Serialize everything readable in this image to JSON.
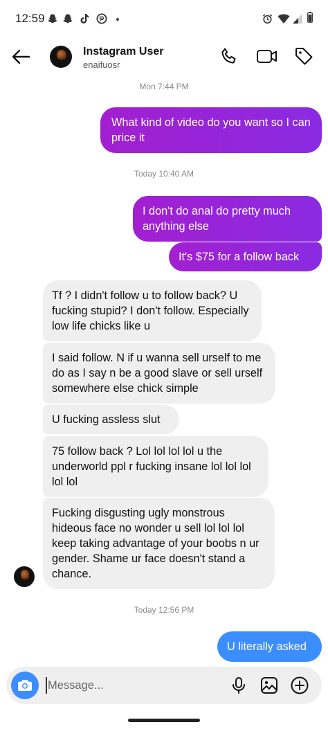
{
  "status_bar": {
    "time": "12:59",
    "icons": [
      "snapchat-icon",
      "snapchat-icon",
      "tiktok-icon",
      "pinterest-icon",
      "dot-icon",
      "alarm-icon",
      "wifi-icon",
      "signal-icon",
      "battery-icon"
    ]
  },
  "header": {
    "name": "Instagram User",
    "username": "enaifuosr",
    "icons": [
      "back-arrow-icon",
      "phone-icon",
      "video-camera-icon",
      "tag-icon"
    ]
  },
  "timestamps": [
    "Mon 7:44 PM",
    "Today 10:40 AM",
    "Today 12:56 PM"
  ],
  "messages": [
    {
      "from": "me",
      "text": "What kind of video do you want so I can price it"
    },
    {
      "from": "me",
      "text": "I don't do anal do pretty much anything else"
    },
    {
      "from": "me",
      "text": "It's $75 for a follow back"
    },
    {
      "from": "them",
      "text": "Tf ? I didn't follow u to follow back? U fucking stupid? I don't follow. Especially low life chicks like u"
    },
    {
      "from": "them",
      "text": "I said follow. N if u wanna sell urself to me do as I say n be a good slave or sell urself somewhere else chick simple"
    },
    {
      "from": "them",
      "text": "U fucking assless slut"
    },
    {
      "from": "them",
      "text": "75 follow back ? Lol lol lol lol u the underworld ppl r fucking insane lol lol lol lol lol"
    },
    {
      "from": "them",
      "text": "Fucking disgusting ugly monstrous hideous face no wonder u sell lol lol lol keep taking advantage of your boobs n ur gender. Shame ur face doesn't stand a chance."
    },
    {
      "from": "me",
      "text": "U literally asked"
    }
  ],
  "composer": {
    "placeholder": "Message...",
    "icons": [
      "camera-icon",
      "microphone-icon",
      "gallery-icon",
      "plus-circle-icon"
    ]
  },
  "colors": {
    "sent_gradient_start": "#a21fd0",
    "sent_gradient_end": "#8a2be2",
    "sent_blue": "#3c8dff",
    "received_bg": "#efefef",
    "camera_button": "#3c8dff"
  }
}
